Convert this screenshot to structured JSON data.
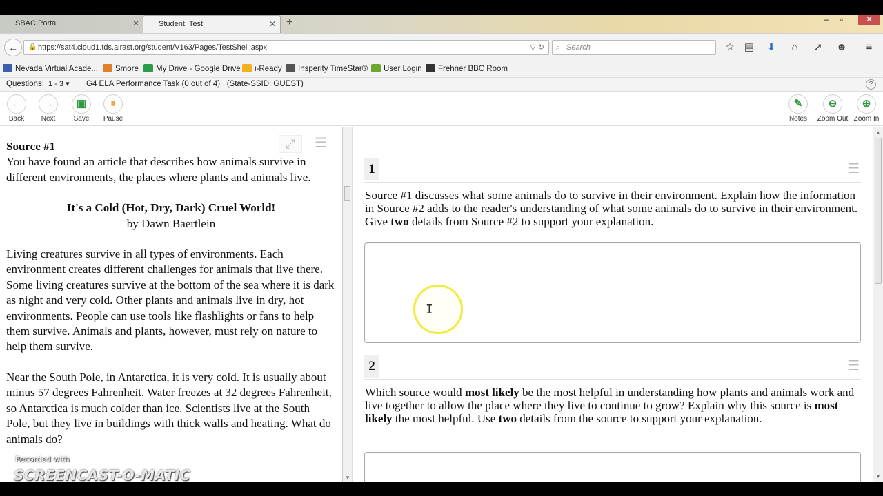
{
  "browser": {
    "tabs": [
      {
        "label": "SBAC Portal"
      },
      {
        "label": "Student: Test"
      }
    ],
    "url": "https://sat4.cloud1.tds.airast.org/student/V163/Pages/TestShell.aspx",
    "search_placeholder": "Search",
    "bookmarks": [
      {
        "label": "Nevada Virtual Acade...",
        "color": "#3b5fa8"
      },
      {
        "label": "Smore",
        "color": "#e0802a"
      },
      {
        "label": "My Drive - Google Drive",
        "color": "#2d9c4a"
      },
      {
        "label": "i-Ready",
        "color": "#f2b01e"
      },
      {
        "label": "Insperity TimeStar®",
        "color": "#555555"
      },
      {
        "label": "User Login",
        "color": "#6aa82f"
      },
      {
        "label": "Frehner BBC Room",
        "color": "#333333"
      }
    ]
  },
  "testbar": {
    "questions_label": "Questions:",
    "questions_value": "1 - 3",
    "test_name": "G4 ELA Performance Task (0 out of 4)   (State-SSID: GUEST)",
    "help": "?"
  },
  "toolbar": {
    "back": "Back",
    "next": "Next",
    "save": "Save",
    "pause": "Pause",
    "notes": "Notes",
    "zoom_out": "Zoom Out",
    "zoom_in": "Zoom In"
  },
  "passage": {
    "source_title": "Source #1",
    "intro": "You have found an article that describes how animals survive in different environments, the places where plants and animals live.",
    "article_title": "It's a Cold (Hot, Dry, Dark) Cruel World!",
    "byline": "by Dawn Baertlein",
    "paragraphs": [
      "Living creatures survive in all types of environments. Each environment creates different challenges for animals that live there. Some living creatures survive at the bottom of the sea where it is dark as night and very cold. Other plants and animals live in dry, hot environments. People can use tools like flashlights or fans to help them survive. Animals and plants, however, must rely on nature to help them survive.",
      "Near the South Pole, in Antarctica, it is very cold. It is usually about minus 57 degrees Fahrenheit. Water freezes at 32 degrees Fahrenheit, so Antarctica is much colder than ice. Scientists live at the South Pole, but they live in buildings with thick walls and heating. What do animals do?"
    ]
  },
  "questions": [
    {
      "number": "1",
      "text_parts": [
        "Source #1 discusses what some animals do to survive in their environment. Explain how the information in Source #2 adds to the reader's understanding of what some animals do to survive in their environment. Give ",
        "two",
        " details from Source #2 to support your explanation."
      ]
    },
    {
      "number": "2",
      "text_parts": [
        "Which source would ",
        "most likely",
        " be the most helpful in understanding how plants and animals work and live together to allow the place where they live to continue to grow? Explain why this source is ",
        "most likely",
        " the most helpful. Use ",
        "two",
        " details from the source to support your explanation."
      ]
    }
  ],
  "watermark": {
    "recorded": "Recorded with",
    "brand": "SCREENCAST-O-MATIC"
  }
}
